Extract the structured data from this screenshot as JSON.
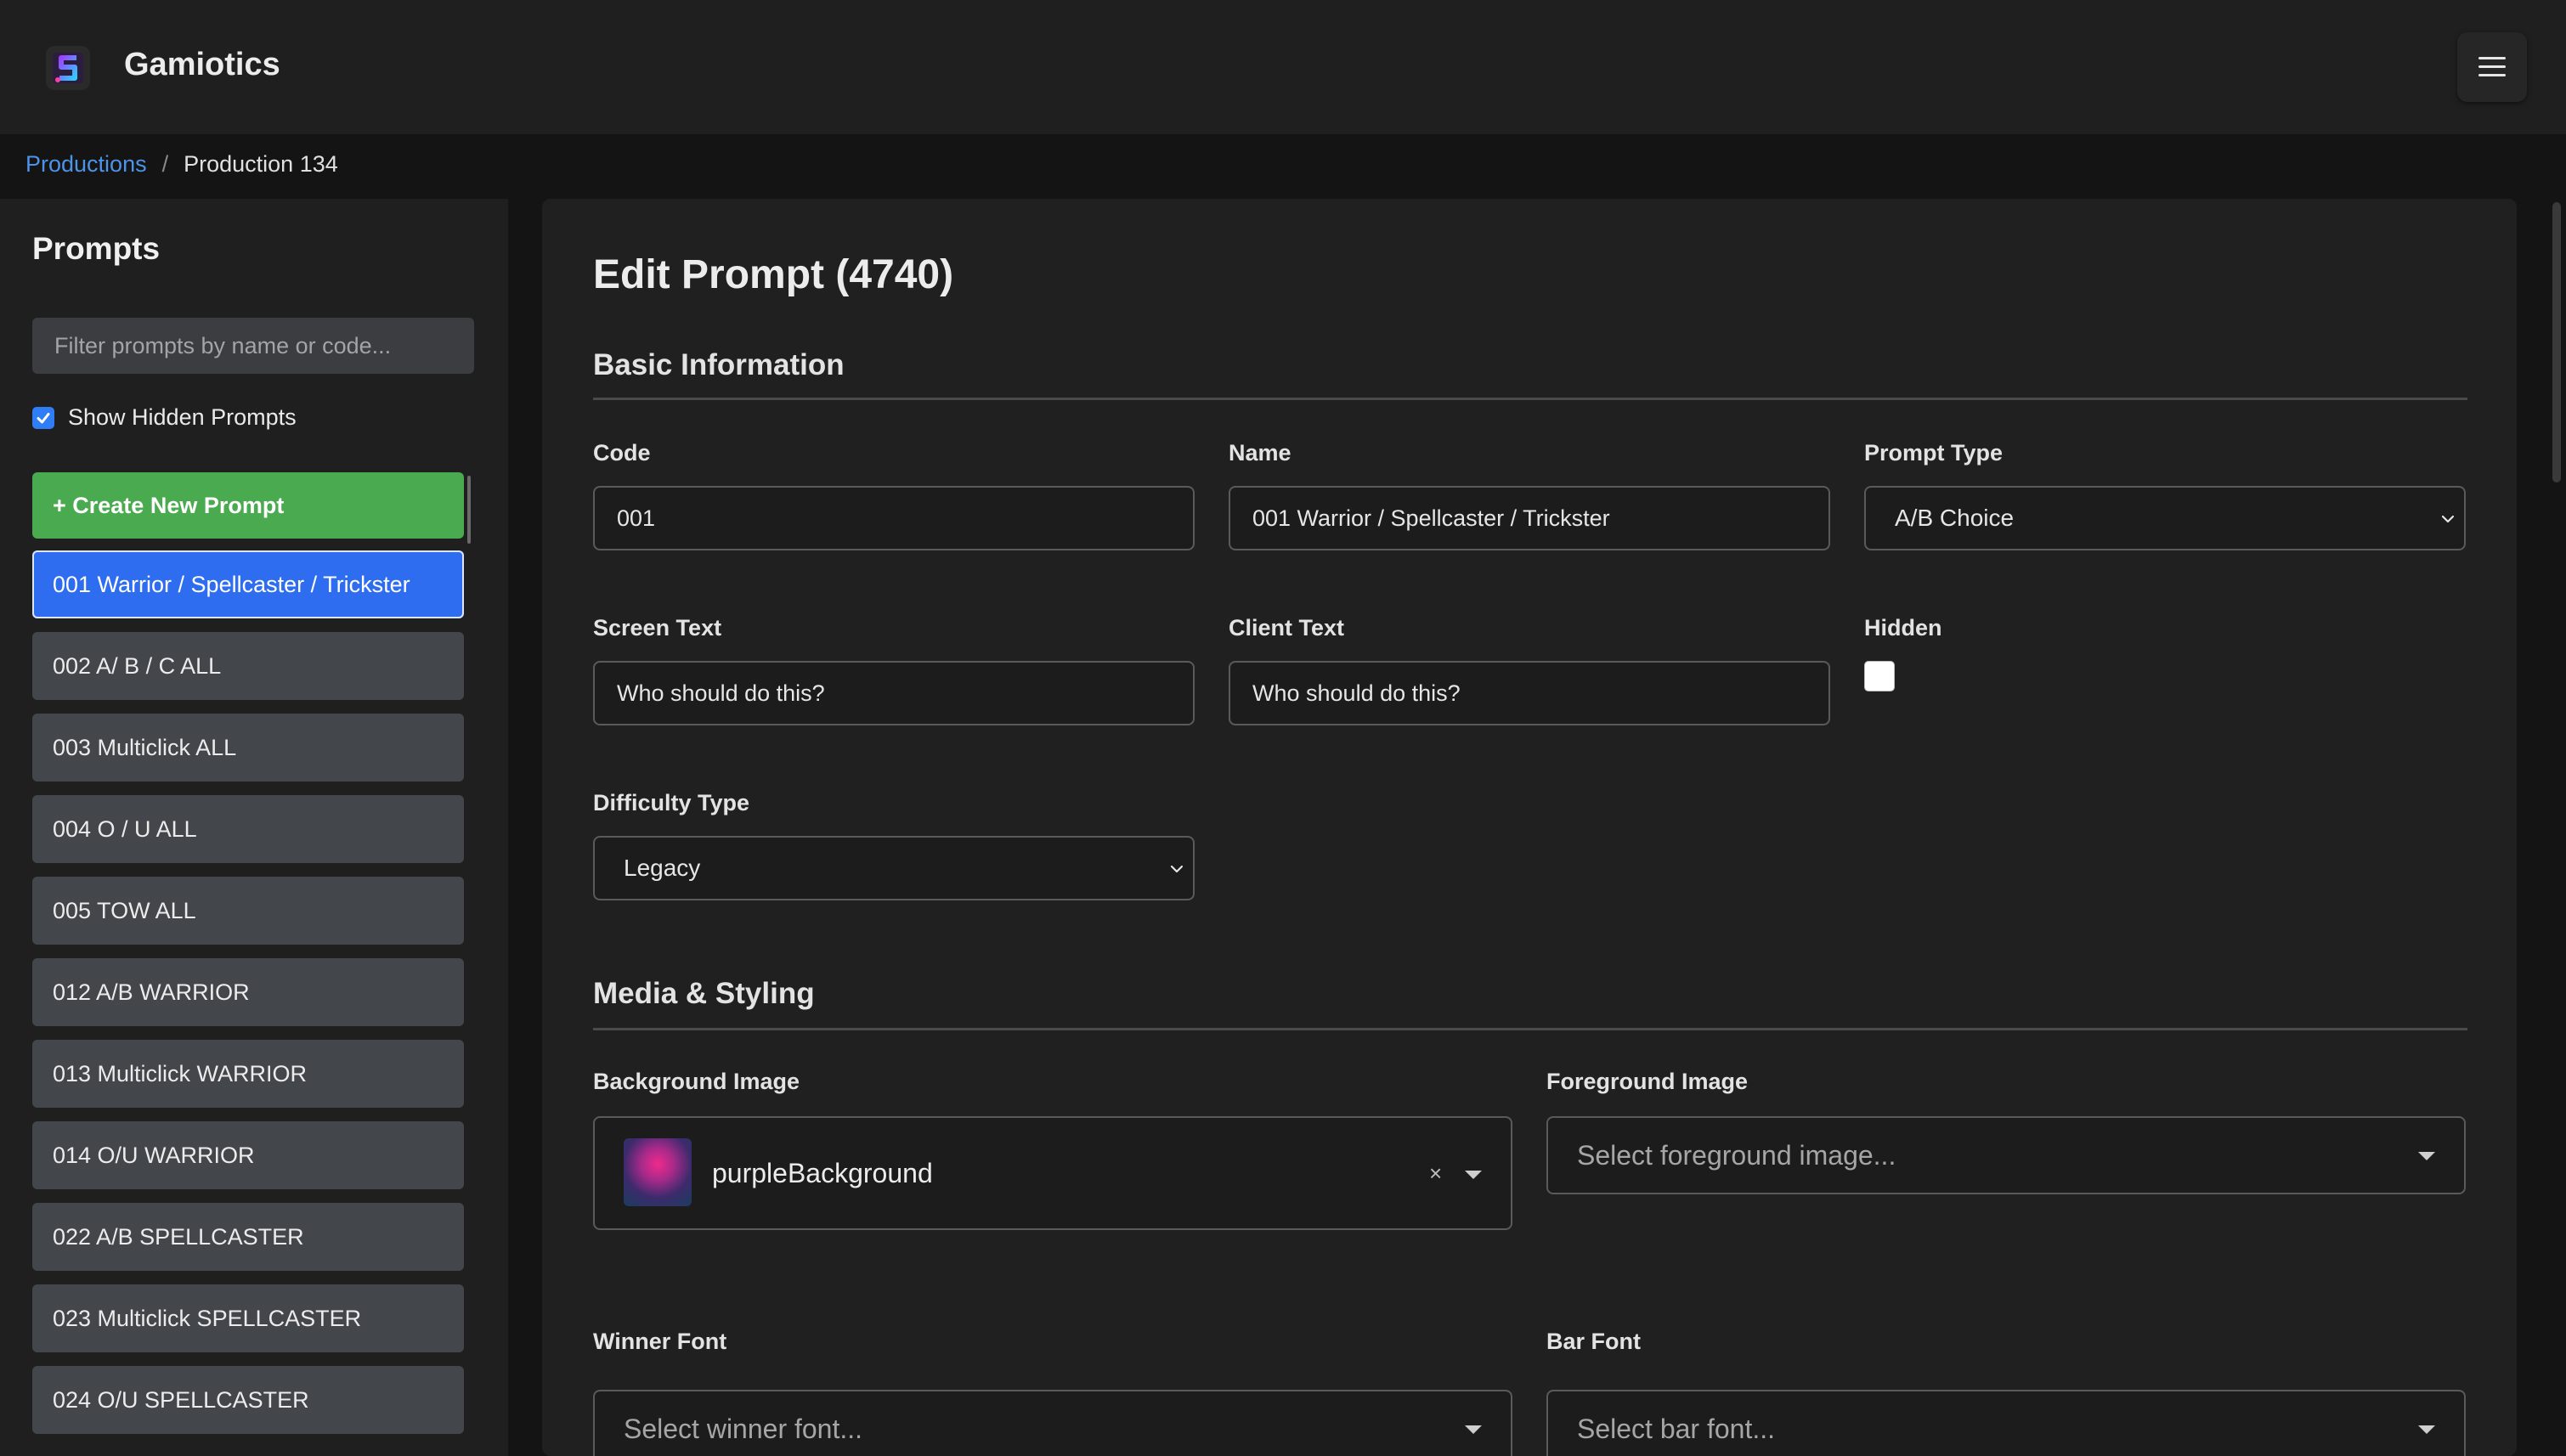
{
  "app": {
    "title": "Gamiotics"
  },
  "breadcrumb": {
    "root": "Productions",
    "separator": "/",
    "current": "Production 134"
  },
  "sidebar": {
    "title": "Prompts",
    "filter_placeholder": "Filter prompts by name or code...",
    "show_hidden_label": "Show Hidden Prompts",
    "show_hidden_checked": true,
    "create_label": "+ Create New Prompt",
    "items": [
      {
        "label": "001 Warrior / Spellcaster / Trickster",
        "active": true
      },
      {
        "label": "002 A/ B / C ALL"
      },
      {
        "label": "003 Multiclick ALL"
      },
      {
        "label": "004 O / U ALL"
      },
      {
        "label": "005 TOW ALL"
      },
      {
        "label": "012 A/B WARRIOR"
      },
      {
        "label": "013 Multiclick WARRIOR"
      },
      {
        "label": "014 O/U WARRIOR"
      },
      {
        "label": "022 A/B SPELLCASTER"
      },
      {
        "label": "023 Multiclick SPELLCASTER"
      },
      {
        "label": "024 O/U SPELLCASTER"
      }
    ]
  },
  "main": {
    "title": "Edit Prompt (4740)",
    "basic": {
      "title": "Basic Information",
      "code_label": "Code",
      "code_value": "001",
      "name_label": "Name",
      "name_value": "001 Warrior / Spellcaster / Trickster",
      "type_label": "Prompt Type",
      "type_value": "A/B Choice",
      "screen_label": "Screen Text",
      "screen_value": "Who should do this?",
      "client_label": "Client Text",
      "client_value": "Who should do this?",
      "hidden_label": "Hidden",
      "hidden_checked": false,
      "difficulty_label": "Difficulty Type",
      "difficulty_value": "Legacy"
    },
    "media": {
      "title": "Media & Styling",
      "bg_label": "Background Image",
      "bg_value": "purpleBackground",
      "clear_symbol": "×",
      "fg_label": "Foreground Image",
      "fg_placeholder": "Select foreground image...",
      "winner_label": "Winner Font",
      "winner_placeholder": "Select winner font...",
      "bar_label": "Bar Font",
      "bar_placeholder": "Select bar font..."
    }
  },
  "colors": {
    "accent_blue": "#2f6df0",
    "link_blue": "#4d93e8",
    "create_green": "#4aaa4f",
    "list_item": "#43464b"
  }
}
